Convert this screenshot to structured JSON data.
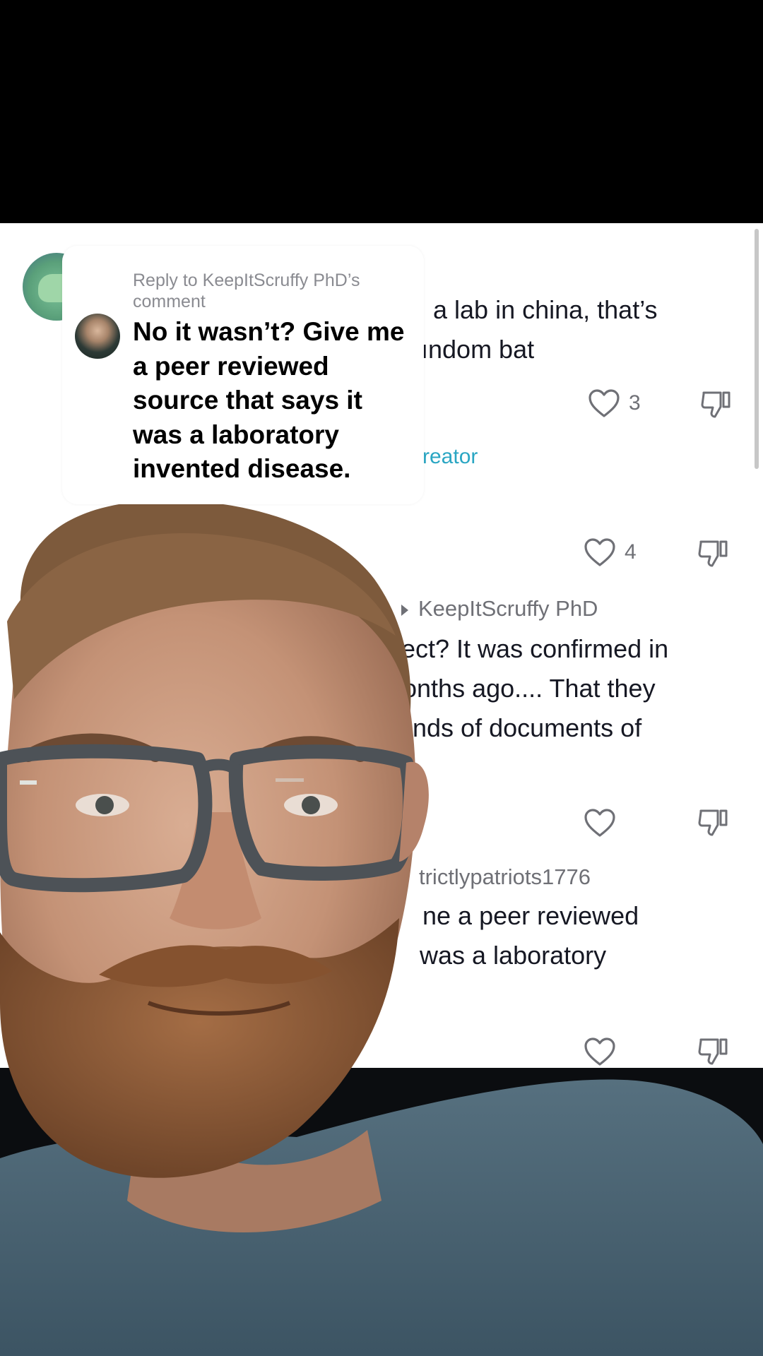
{
  "comments_panel": {
    "comment1": {
      "lines": [
        "a lab in china, that’s",
        "ındom bat"
      ],
      "like_count": "3"
    },
    "creator_reply_link": "reator",
    "comment2": {
      "like_count": "4"
    },
    "reply_thread": {
      "header": "KeepItScruffy PhD",
      "lines": [
        "ect? It was confirmed in",
        "onths ago.... That they",
        "ınds of documents of"
      ]
    },
    "comment4": {
      "username": "trictlypatriots1776",
      "lines": [
        "ne a peer reviewed",
        "was a laboratory"
      ]
    }
  },
  "sticker": {
    "label": "Reply to KeepItScruffy PhD’s comment",
    "text": "No it wasn’t? Give me a peer reviewed source that says it was a laboratory invented disease."
  },
  "colors": {
    "link_teal": "#2aa6c3",
    "muted_gray": "#6f7076",
    "skin": "#c99a7f",
    "beard": "#8a5a3a",
    "shirt": "#4c6477"
  },
  "icons": [
    "heart-icon",
    "dislike-icon",
    "reply-arrow-icon"
  ]
}
